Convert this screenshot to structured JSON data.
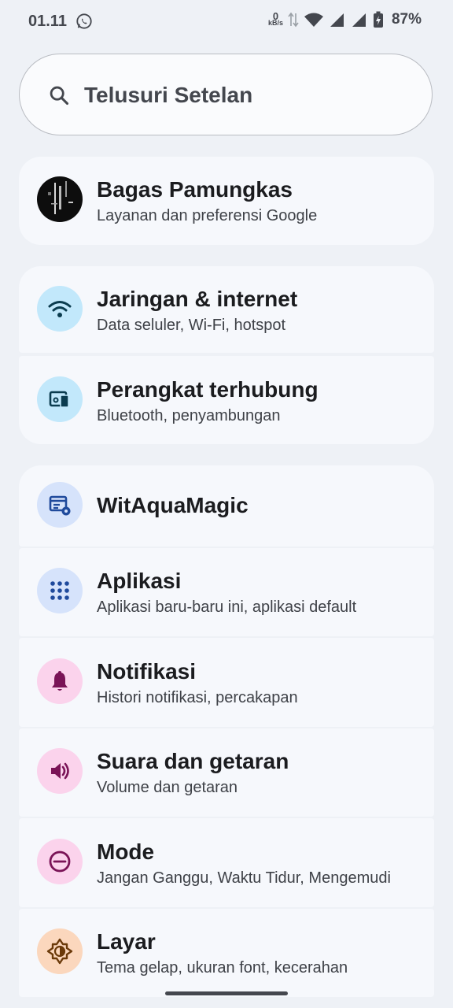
{
  "status": {
    "time": "01.11",
    "net_speed_value": "0",
    "net_speed_unit": "kB/s",
    "battery": "87%"
  },
  "search": {
    "placeholder": "Telusuri Setelan"
  },
  "account": {
    "name": "Bagas Pamungkas",
    "subtitle": "Layanan dan preferensi Google"
  },
  "settings": [
    {
      "title": "Jaringan & internet",
      "subtitle": "Data seluler, Wi-Fi, hotspot",
      "icon": "wifi-icon",
      "color": "#c2e8fb"
    },
    {
      "title": "Perangkat terhubung",
      "subtitle": "Bluetooth, penyambungan",
      "icon": "devices-icon",
      "color": "#c2e8fb"
    },
    {
      "title": "WitAquaMagic",
      "subtitle": "",
      "icon": "rom-settings-icon",
      "color": "#d6e3fb"
    },
    {
      "title": "Aplikasi",
      "subtitle": "Aplikasi baru-baru ini, aplikasi default",
      "icon": "apps-grid-icon",
      "color": "#d6e3fb"
    },
    {
      "title": "Notifikasi",
      "subtitle": "Histori notifikasi, percakapan",
      "icon": "bell-icon",
      "color": "#fbd3ec"
    },
    {
      "title": "Suara dan getaran",
      "subtitle": "Volume dan getaran",
      "icon": "speaker-icon",
      "color": "#fbd3ec"
    },
    {
      "title": "Mode",
      "subtitle": "Jangan Ganggu, Waktu Tidur, Mengemudi",
      "icon": "minus-circle-icon",
      "color": "#fbd3ec"
    },
    {
      "title": "Layar",
      "subtitle": "Tema gelap, ukuran font, kecerahan",
      "icon": "brightness-icon",
      "color": "#fbd7bd"
    }
  ]
}
